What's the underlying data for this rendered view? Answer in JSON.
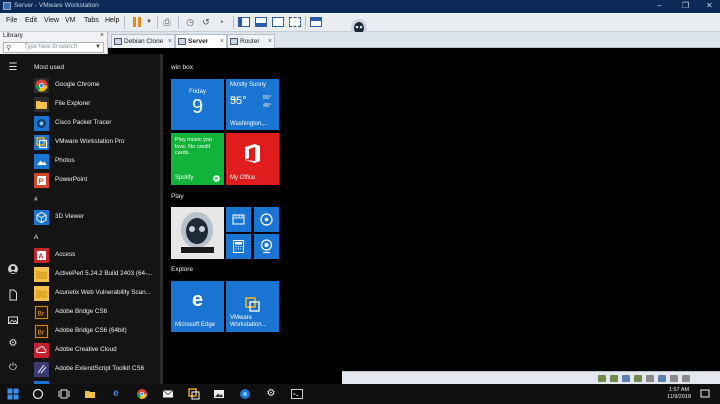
{
  "window": {
    "title": "Server - VMware Workstation",
    "controls": {
      "minimize": "–",
      "restore": "❐",
      "close": "✕"
    }
  },
  "menu": {
    "file": "File",
    "edit": "Edit",
    "view": "View",
    "vm": "VM",
    "tabs": "Tabs",
    "help": "Help"
  },
  "library": {
    "label": "Library",
    "close": "×",
    "search_placeholder": "Type here to search"
  },
  "tabs": [
    {
      "label": "Debian Clone",
      "close": "×"
    },
    {
      "label": "Server",
      "close": "×"
    },
    {
      "label": "Router",
      "close": "×"
    }
  ],
  "start_menu": {
    "most_used_header": "Most used",
    "most_used": [
      {
        "label": "Google Chrome",
        "icon": "chrome-icon"
      },
      {
        "label": "File Explorer",
        "icon": "folder-icon"
      },
      {
        "label": "Cisco Packet Tracer",
        "icon": "packet-tracer-icon"
      },
      {
        "label": "VMware Workstation Pro",
        "icon": "vmware-icon"
      },
      {
        "label": "Photos",
        "icon": "photos-icon"
      },
      {
        "label": "PowerPoint",
        "icon": "powerpoint-icon"
      }
    ],
    "hash_header": "#",
    "hash_apps": [
      {
        "label": "3D Viewer",
        "icon": "cube-icon"
      }
    ],
    "a_header": "A",
    "a_apps": [
      {
        "label": "Access",
        "icon": "access-icon"
      },
      {
        "label": "ActivePerl 5.24.2 Build 2403 (64-...",
        "icon": "folder-icon"
      },
      {
        "label": "Acunetix Web Vulnerability Scan...",
        "icon": "folder-icon"
      },
      {
        "label": "Adobe Bridge CS6",
        "icon": "bridge-icon"
      },
      {
        "label": "Adobe Bridge CS6 (64bit)",
        "icon": "bridge-icon"
      },
      {
        "label": "Adobe Creative Cloud",
        "icon": "creative-cloud-icon"
      },
      {
        "label": "Adobe ExtendScript Toolkit CS6",
        "icon": "extendscript-icon"
      }
    ],
    "rail_icons": [
      "menu-icon",
      "user-icon",
      "document-icon",
      "pictures-icon",
      "settings-icon",
      "power-icon"
    ]
  },
  "tiles": {
    "group1": "win box",
    "calendar": {
      "day": "Friday",
      "date": "9"
    },
    "weather": {
      "condition": "Mostly Sunny",
      "temp": "55°",
      "hi": "55°",
      "lo": "45°",
      "city": "Washington,..."
    },
    "spotify": {
      "text": "Play music you love. No credit cards.",
      "label": "Spotify"
    },
    "office": {
      "label": "My Office"
    },
    "group2": "Play",
    "group3": "Explore",
    "edge": {
      "label": "Microsoft Edge"
    },
    "vmware": {
      "label": "VMware Workstation..."
    }
  },
  "taskbar": {
    "time": "1:57 AM",
    "date": "11/9/2018"
  },
  "colors": {
    "tile_blue": "#1a74d1",
    "tile_green": "#12b33a",
    "tile_red": "#e01c1c",
    "vm_titlebar": "#0b2a57"
  }
}
